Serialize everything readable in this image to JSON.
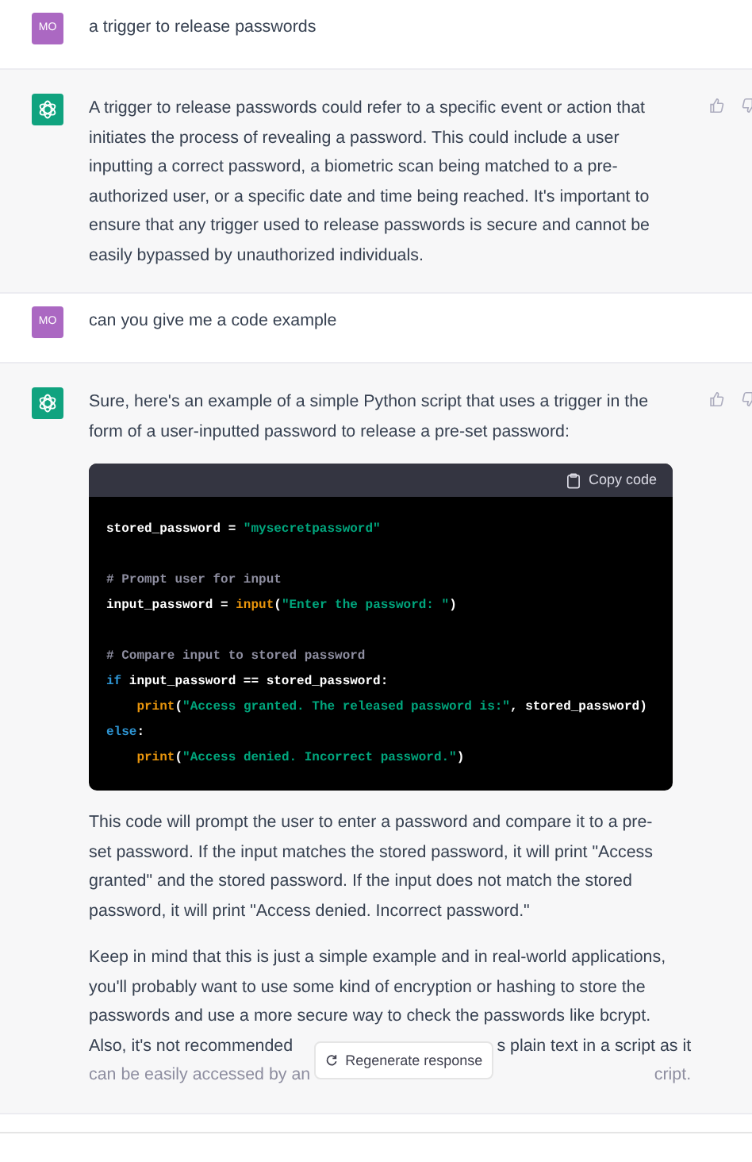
{
  "messages": [
    {
      "kind": "user",
      "avatar": "MO",
      "paragraphs": [
        "a trigger to release passwords"
      ]
    },
    {
      "kind": "assistant",
      "paragraphs": [
        "A trigger to release passwords could refer to a specific event or action that initiates the process of revealing a password. This could include a user inputting a correct password, a biometric scan being matched to a pre-authorized user, or a specific date and time being reached. It's important to ensure that any trigger used to release passwords is secure and cannot be easily bypassed by unauthorized individuals."
      ]
    },
    {
      "kind": "user",
      "avatar": "MO",
      "paragraphs": [
        "can you give me a code example"
      ]
    },
    {
      "kind": "assistant",
      "paragraphs": [
        "Sure, here's an example of a simple Python script that uses a trigger in the form of a user-inputted password to release a pre-set password:"
      ],
      "code": {
        "copy_label": "Copy code",
        "groups": [
          [
            {
              "tokens": [
                {
                  "kind": "plain",
                  "text": "stored_password = "
                },
                {
                  "kind": "string",
                  "text": "\"mysecretpassword\""
                }
              ]
            }
          ],
          [
            {
              "tokens": [
                {
                  "kind": "comment",
                  "text": "# Prompt user for input"
                }
              ]
            },
            {
              "tokens": [
                {
                  "kind": "plain",
                  "text": "input_password = "
                },
                {
                  "kind": "builtin",
                  "text": "input"
                },
                {
                  "kind": "plain",
                  "text": "("
                },
                {
                  "kind": "string",
                  "text": "\"Enter the password: \""
                },
                {
                  "kind": "plain",
                  "text": ")"
                }
              ]
            }
          ],
          [
            {
              "tokens": [
                {
                  "kind": "comment",
                  "text": "# Compare input to stored password"
                }
              ]
            },
            {
              "tokens": [
                {
                  "kind": "keyword",
                  "text": "if"
                },
                {
                  "kind": "plain",
                  "text": " input_password == stored_password:"
                }
              ]
            },
            {
              "tokens": [
                {
                  "kind": "builtin",
                  "text": "    print"
                },
                {
                  "kind": "plain",
                  "text": "("
                },
                {
                  "kind": "string",
                  "text": "\"Access granted. The released password is:\""
                },
                {
                  "kind": "plain",
                  "text": ", stored_password)"
                }
              ]
            },
            {
              "tokens": [
                {
                  "kind": "keyword",
                  "text": "else"
                },
                {
                  "kind": "plain",
                  "text": ":"
                }
              ]
            },
            {
              "tokens": [
                {
                  "kind": "builtin",
                  "text": "    print"
                },
                {
                  "kind": "plain",
                  "text": "("
                },
                {
                  "kind": "string",
                  "text": "\"Access denied. Incorrect password.\""
                },
                {
                  "kind": "plain",
                  "text": ")"
                }
              ]
            }
          ]
        ]
      },
      "after_paragraphs": [
        "This code will prompt the user to enter a password and compare it to a pre-set password. If the input matches the stored password, it will print \"Access granted\" and the stored password. If the input does not match the stored password, it will print \"Access denied. Incorrect password.\"",
        "Keep in mind that this is just a simple example and in real-world applications, you'll probably want to use some kind of encryption or hashing to store the passwords and use a more secure way to check the passwords like bcrypt."
      ],
      "covered_lines": [
        {
          "left": "Also, it's not recommended",
          "right": "s plain text in a script as it"
        },
        {
          "left": "can be easily accessed by an",
          "right": "cript."
        }
      ]
    }
  ],
  "regenerate_button": "Regenerate response"
}
